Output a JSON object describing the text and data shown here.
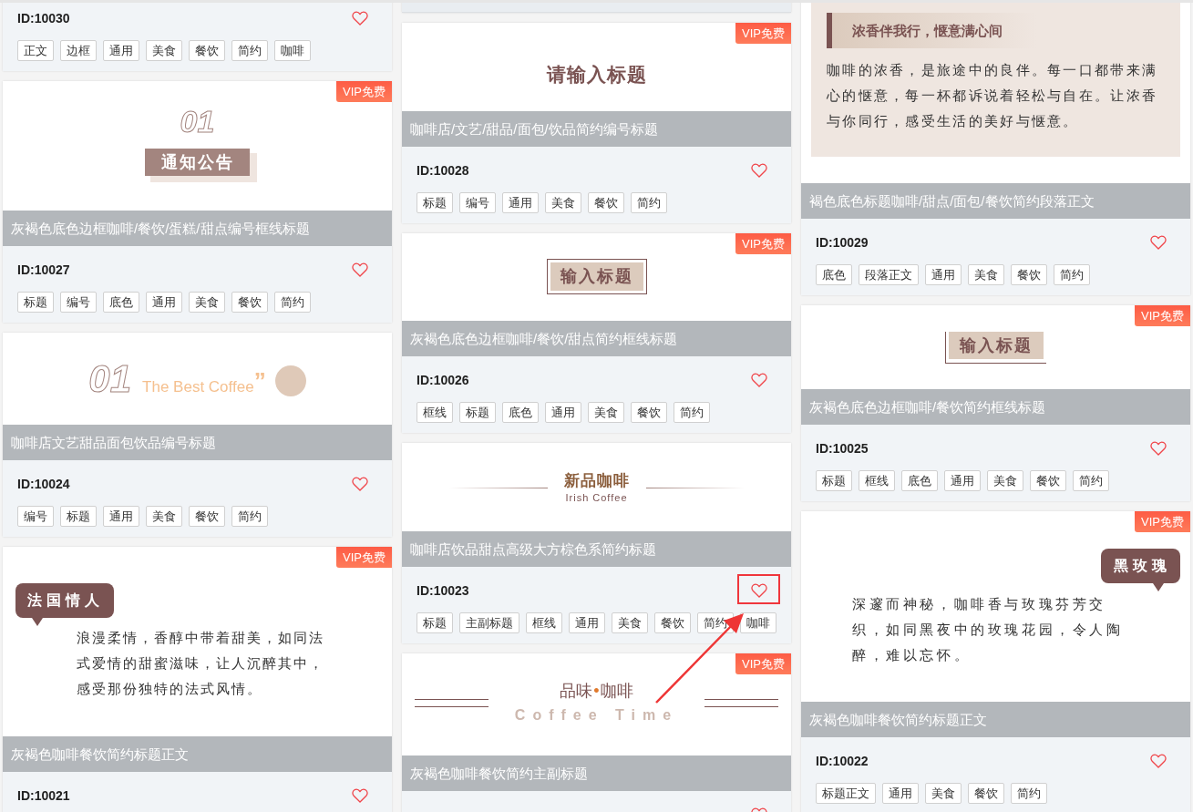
{
  "columns": [
    {
      "cards": [
        {
          "id": "ID:10030",
          "tags": [
            "正文",
            "边框",
            "通用",
            "美食",
            "餐饮",
            "简约",
            "咖啡"
          ],
          "heart_highlighted": false
        },
        {
          "badge": "VIP免费",
          "preview": {
            "kind": "number-notice",
            "number": "01",
            "heading": "通知公告"
          },
          "title": "灰褐色底色边框咖啡/餐饮/蛋糕/甜点编号框线标题",
          "id": "ID:10027",
          "tags": [
            "标题",
            "编号",
            "底色",
            "通用",
            "美食",
            "餐饮",
            "简约"
          ],
          "heart_highlighted": false
        },
        {
          "preview": {
            "kind": "number-english",
            "number": "01",
            "english": "The Best Coffee",
            "quote": "”"
          },
          "title": "咖啡店文艺甜品面包饮品编号标题",
          "id": "ID:10024",
          "tags": [
            "编号",
            "标题",
            "通用",
            "美食",
            "餐饮",
            "简约"
          ],
          "heart_highlighted": false
        },
        {
          "badge": "VIP免费",
          "preview": {
            "kind": "bubble-left",
            "heading": "法国情人",
            "paragraph": "浪漫柔情，香醇中带着甜美，如同法式爱情的甜蜜滋味，让人沉醉其中，感受那份独特的法式风情。"
          },
          "title": "灰褐色咖啡餐饮简约标题正文",
          "id": "ID:10021",
          "heart_highlighted": false
        }
      ]
    },
    {
      "cards": [
        {
          "kind": "footer-strip"
        },
        {
          "badge": "VIP免费",
          "preview": {
            "kind": "number-watermark",
            "heading": "请输入标题"
          },
          "title": "咖啡店/文艺/甜品/面包/饮品简约编号标题",
          "id": "ID:10028",
          "tags": [
            "标题",
            "编号",
            "通用",
            "美食",
            "餐饮",
            "简约"
          ],
          "heart_highlighted": false
        },
        {
          "badge": "VIP免费",
          "preview": {
            "kind": "framed",
            "heading": "输入标题"
          },
          "title": "灰褐色底色边框咖啡/餐饮/甜点简约框线标题",
          "id": "ID:10026",
          "tags": [
            "框线",
            "标题",
            "底色",
            "通用",
            "美食",
            "餐饮",
            "简约"
          ],
          "heart_highlighted": false
        },
        {
          "preview": {
            "kind": "lines-center",
            "heading": "新品咖啡",
            "english": "Irish Coffee"
          },
          "title": "咖啡店饮品甜点高级大方棕色系简约标题",
          "id": "ID:10023",
          "tags": [
            "标题",
            "主副标题",
            "框线",
            "通用",
            "美食",
            "餐饮",
            "简约",
            "咖啡"
          ],
          "heart_highlighted": true
        },
        {
          "badge": "VIP免费",
          "preview": {
            "kind": "double-lines",
            "heading_left": "品味",
            "dot": "•",
            "heading_right": "咖啡",
            "english": "Coffee Time"
          },
          "title": "灰褐色咖啡餐饮简约主副标题",
          "heart_highlighted": false
        }
      ]
    },
    {
      "cards": [
        {
          "preview": {
            "kind": "quote-paragraph",
            "heading": "浓香伴我行，惬意满心间",
            "paragraph": "咖啡的浓香，是旅途中的良伴。每一口都带来满心的惬意，每一杯都诉说着轻松与自在。让浓香与你同行，感受生活的美好与惬意。"
          },
          "title": "褐色底色标题咖啡/甜点/面包/餐饮简约段落正文",
          "id": "ID:10029",
          "tags": [
            "底色",
            "段落正文",
            "通用",
            "美食",
            "餐饮",
            "简约"
          ],
          "heart_highlighted": false
        },
        {
          "badge": "VIP免费",
          "preview": {
            "kind": "corner-frame",
            "heading": "输入标题"
          },
          "title": "灰褐色底色边框咖啡/餐饮简约框线标题",
          "id": "ID:10025",
          "tags": [
            "标题",
            "框线",
            "底色",
            "通用",
            "美食",
            "餐饮",
            "简约"
          ],
          "heart_highlighted": false
        },
        {
          "badge": "VIP免费",
          "preview": {
            "kind": "bubble-right",
            "heading": "黑玫瑰",
            "paragraph": "深邃而神秘，咖啡香与玫瑰芬芳交织，如同黑夜中的玫瑰花园，令人陶醉，难以忘怀。"
          },
          "title": "灰褐色咖啡餐饮简约标题正文",
          "id": "ID:10022",
          "tags": [
            "标题正文",
            "通用",
            "美食",
            "餐饮",
            "简约"
          ],
          "heart_highlighted": false
        }
      ]
    }
  ]
}
